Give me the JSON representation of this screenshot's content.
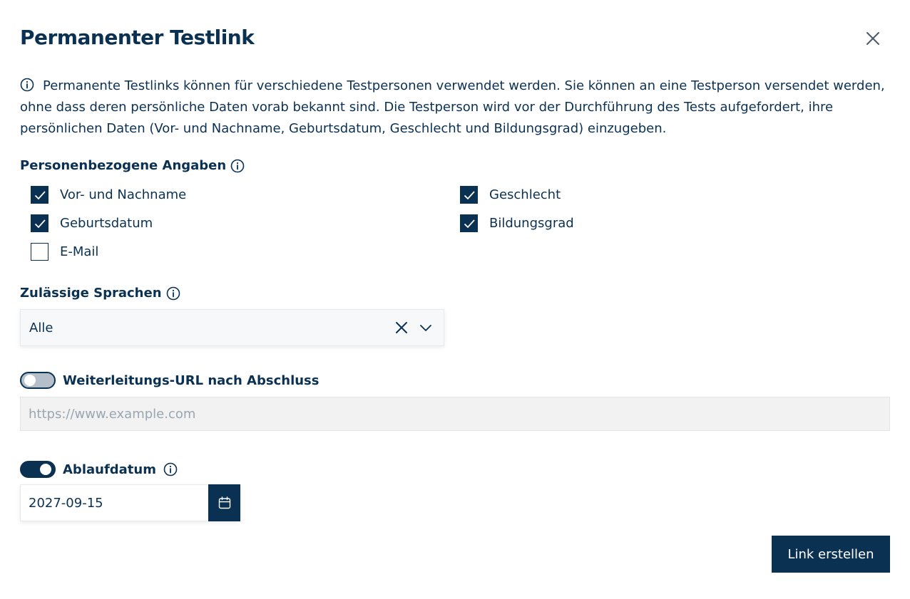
{
  "dialog": {
    "title": "Permanenter Testlink",
    "info_text": "Permanente Testlinks können für verschiedene Testpersonen verwendet werden. Sie können an eine Testperson versendet werden, ohne dass deren persönliche Daten vorab bekannt sind. Die Testperson wird vor der Durchführung des Tests aufgefordert, ihre persönlichen Daten (Vor- und Nachname, Geburtsdatum, Geschlecht und Bildungsgrad) einzugeben."
  },
  "personal_data": {
    "label": "Personenbezogene Angaben",
    "options": [
      {
        "label": "Vor- und Nachname",
        "checked": true
      },
      {
        "label": "Geburtsdatum",
        "checked": true
      },
      {
        "label": "E-Mail",
        "checked": false
      },
      {
        "label": "Geschlecht",
        "checked": true
      },
      {
        "label": "Bildungsgrad",
        "checked": true
      }
    ]
  },
  "languages": {
    "label": "Zulässige Sprachen",
    "selected": "Alle"
  },
  "redirect": {
    "label": "Weiterleitungs-URL nach Abschluss",
    "enabled": false,
    "value": "",
    "placeholder": "https://www.example.com"
  },
  "expiry": {
    "label": "Ablaufdatum",
    "enabled": true,
    "value": "2027-09-15"
  },
  "actions": {
    "create_label": "Link erstellen"
  },
  "colors": {
    "primary": "#0b3152",
    "toggle_off": "#b5bfca",
    "url_bg": "#f2f2f2",
    "select_bg": "#f6f8fa"
  },
  "icons": [
    "close-icon",
    "info-icon",
    "check-icon",
    "clear-icon",
    "chevron-down-icon",
    "calendar-icon"
  ]
}
